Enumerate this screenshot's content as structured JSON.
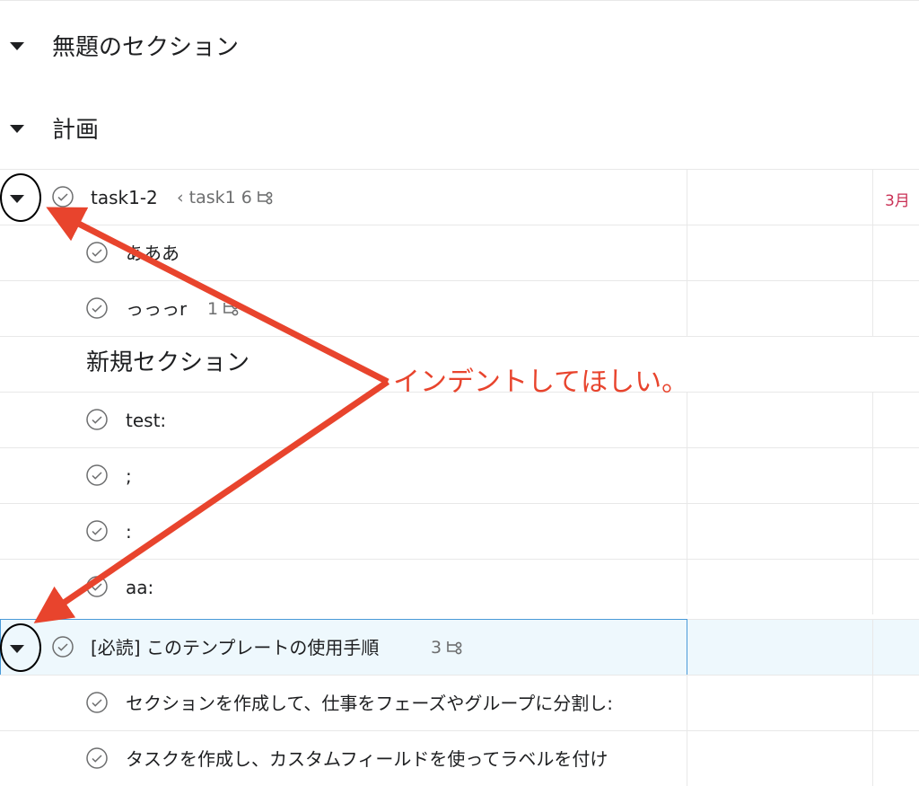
{
  "sections": [
    {
      "title": "無題のセクション"
    },
    {
      "title": "計画"
    }
  ],
  "parent_task": {
    "name": "task1-2",
    "parent_link": "‹ task1",
    "subtask_count": "6",
    "due": "3月"
  },
  "subtasks_a": [
    {
      "name": "あああ"
    },
    {
      "name": "っっっr",
      "subtask_count": "1"
    }
  ],
  "new_section": {
    "title": "新規セクション"
  },
  "subtasks_b": [
    {
      "name": "test:"
    },
    {
      "name": ";"
    },
    {
      "name": ":"
    },
    {
      "name": "aa:"
    }
  ],
  "template_task": {
    "name": "[必読] このテンプレートの使用手順",
    "subtask_count": "3"
  },
  "template_subtasks": [
    {
      "name": "セクションを作成して、仕事をフェーズやグループに分割し:"
    },
    {
      "name": "タスクを作成し、カスタムフィールドを使ってラベルを付け"
    }
  ],
  "annotation": {
    "text": "インデントしてほしい。"
  },
  "colors": {
    "annotation": "#e8442d",
    "due": "#c92f54",
    "selected_bg": "#eef8fd",
    "selected_border": "#4a9ad8"
  },
  "icons": [
    "caret-down-icon",
    "check-circle-icon",
    "subtask-icon"
  ]
}
